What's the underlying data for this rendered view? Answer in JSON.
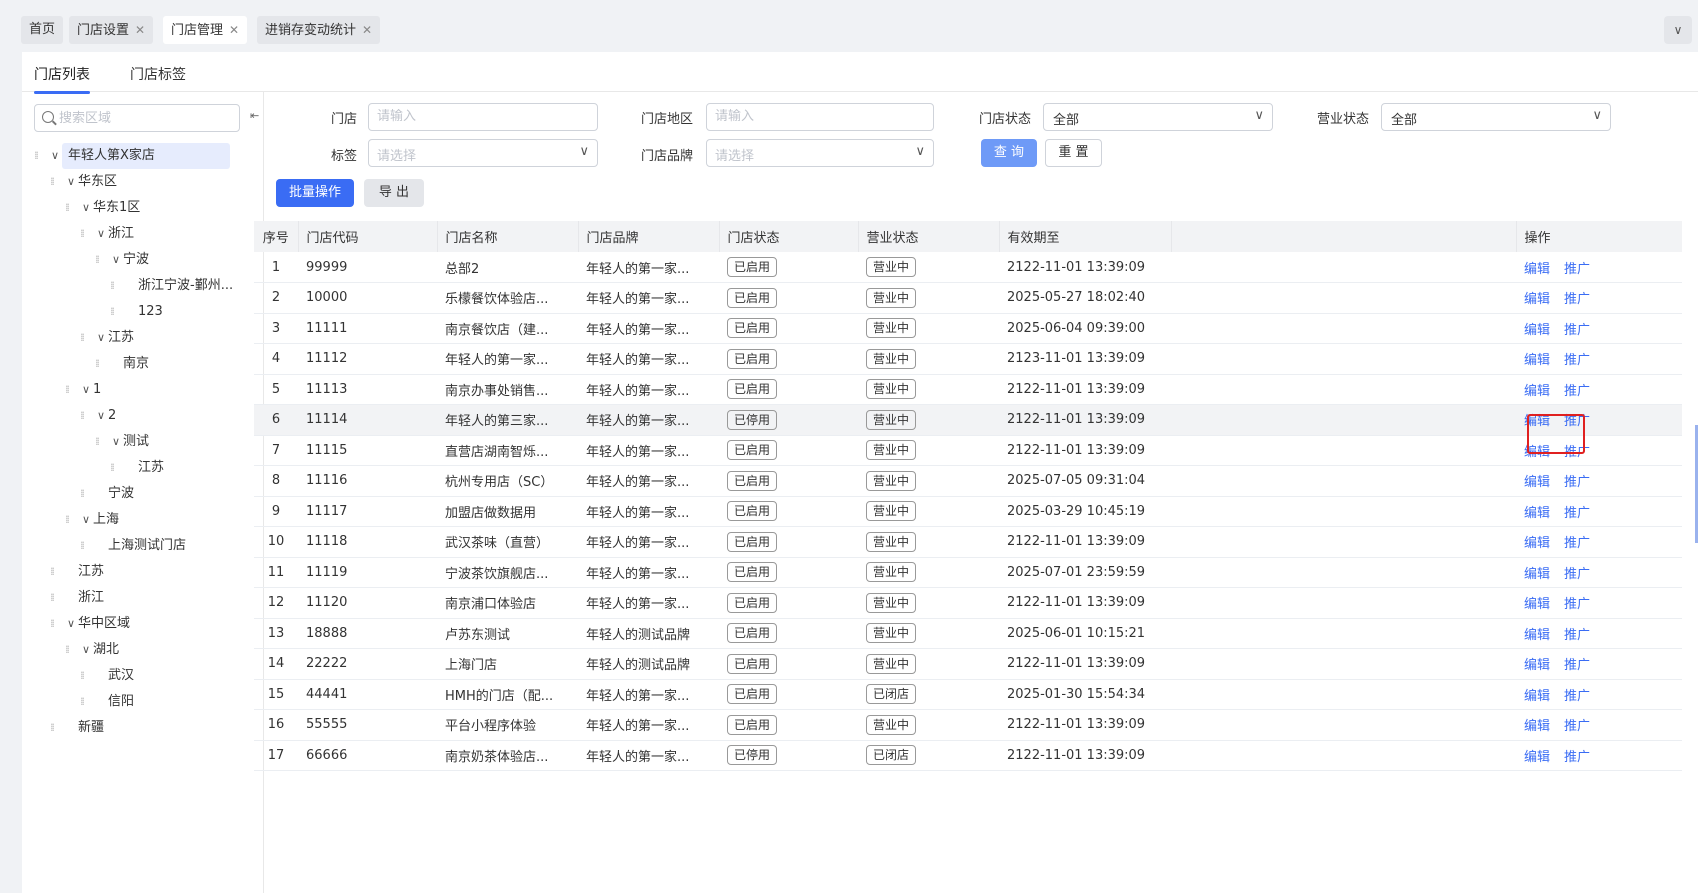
{
  "top_tabs": [
    {
      "label": "首页",
      "closable": false
    },
    {
      "label": "门店设置",
      "closable": true
    },
    {
      "label": "门店管理",
      "closable": true,
      "active": true
    },
    {
      "label": "进销存变动统计",
      "closable": true
    }
  ],
  "sub_tabs": [
    "门店列表",
    "门店标签"
  ],
  "tree": {
    "search_placeholder": "搜索区域",
    "nodes": [
      {
        "label": "年轻人第X家店",
        "level": 0,
        "expanded": true,
        "selected": true
      },
      {
        "label": "华东区",
        "level": 1,
        "expanded": true
      },
      {
        "label": "华东1区",
        "level": 2,
        "expanded": true
      },
      {
        "label": "浙江",
        "level": 3,
        "expanded": true
      },
      {
        "label": "宁波",
        "level": 4,
        "expanded": true
      },
      {
        "label": "浙江宁波-鄞州...",
        "level": 5,
        "leaf": true
      },
      {
        "label": "123",
        "level": 5,
        "leaf": true
      },
      {
        "label": "江苏",
        "level": 3,
        "expanded": true
      },
      {
        "label": "南京",
        "level": 4,
        "leaf": true
      },
      {
        "label": "1",
        "level": 2,
        "expanded": true
      },
      {
        "label": "2",
        "level": 3,
        "expanded": true
      },
      {
        "label": "测试",
        "level": 4,
        "expanded": true
      },
      {
        "label": "江苏",
        "level": 5,
        "leaf": true
      },
      {
        "label": "宁波",
        "level": 3,
        "leaf": true
      },
      {
        "label": "上海",
        "level": 2,
        "expanded": true
      },
      {
        "label": "上海测试门店",
        "level": 3,
        "leaf": true
      },
      {
        "label": "江苏",
        "level": 1,
        "leaf": true
      },
      {
        "label": "浙江",
        "level": 1,
        "leaf": true
      },
      {
        "label": "华中区域",
        "level": 1,
        "expanded": true
      },
      {
        "label": "湖北",
        "level": 2,
        "expanded": true
      },
      {
        "label": "武汉",
        "level": 3,
        "leaf": true
      },
      {
        "label": "信阳",
        "level": 3,
        "leaf": true
      },
      {
        "label": "新疆",
        "level": 1,
        "leaf": true
      }
    ]
  },
  "filters": {
    "store_label": "门店",
    "store_placeholder": "请输入",
    "region_label": "门店地区",
    "region_placeholder": "请输入",
    "status_label": "门店状态",
    "status_value": "全部",
    "biz_label": "营业状态",
    "biz_value": "全部",
    "tag_label": "标签",
    "tag_placeholder": "请选择",
    "brand_label": "门店品牌",
    "brand_placeholder": "请选择",
    "query_btn": "查 询",
    "reset_btn": "重 置"
  },
  "actions": {
    "batch": "批量操作",
    "export": "导 出"
  },
  "table": {
    "headers": [
      "序号",
      "门店代码",
      "门店名称",
      "门店品牌",
      "门店状态",
      "营业状态",
      "有效期至",
      "操作"
    ],
    "edit_label": "编辑",
    "promote_label": "推广",
    "rows": [
      {
        "idx": "1",
        "code": "99999",
        "name": "总部2",
        "brand": "年轻人的第一家...",
        "status": "已启用",
        "biz": "营业中",
        "expire": "2122-11-01 13:39:09"
      },
      {
        "idx": "2",
        "code": "10000",
        "name": "乐檬餐饮体验店...",
        "brand": "年轻人的第一家...",
        "status": "已启用",
        "biz": "营业中",
        "expire": "2025-05-27 18:02:40"
      },
      {
        "idx": "3",
        "code": "11111",
        "name": "南京餐饮店（建...",
        "brand": "年轻人的第一家...",
        "status": "已启用",
        "biz": "营业中",
        "expire": "2025-06-04 09:39:00"
      },
      {
        "idx": "4",
        "code": "11112",
        "name": "年轻人的第一家...",
        "brand": "年轻人的第一家...",
        "status": "已启用",
        "biz": "营业中",
        "expire": "2123-11-01 13:39:09"
      },
      {
        "idx": "5",
        "code": "11113",
        "name": "南京办事处销售...",
        "brand": "年轻人的第一家...",
        "status": "已启用",
        "biz": "营业中",
        "expire": "2122-11-01 13:39:09"
      },
      {
        "idx": "6",
        "code": "11114",
        "name": "年轻人的第三家...",
        "brand": "年轻人的第一家...",
        "status": "已停用",
        "biz": "营业中",
        "expire": "2122-11-01 13:39:09"
      },
      {
        "idx": "7",
        "code": "11115",
        "name": "直营店湖南智烁...",
        "brand": "年轻人的第一家...",
        "status": "已启用",
        "biz": "营业中",
        "expire": "2122-11-01 13:39:09"
      },
      {
        "idx": "8",
        "code": "11116",
        "name": "杭州专用店（SC）",
        "brand": "年轻人的第一家...",
        "status": "已启用",
        "biz": "营业中",
        "expire": "2025-07-05 09:31:04"
      },
      {
        "idx": "9",
        "code": "11117",
        "name": "加盟店做数据用",
        "brand": "年轻人的第一家...",
        "status": "已启用",
        "biz": "营业中",
        "expire": "2025-03-29 10:45:19"
      },
      {
        "idx": "10",
        "code": "11118",
        "name": "武汉茶味（直营）",
        "brand": "年轻人的第一家...",
        "status": "已启用",
        "biz": "营业中",
        "expire": "2122-11-01 13:39:09"
      },
      {
        "idx": "11",
        "code": "11119",
        "name": "宁波茶饮旗舰店...",
        "brand": "年轻人的第一家...",
        "status": "已启用",
        "biz": "营业中",
        "expire": "2025-07-01 23:59:59"
      },
      {
        "idx": "12",
        "code": "11120",
        "name": "南京浦口体验店",
        "brand": "年轻人的第一家...",
        "status": "已启用",
        "biz": "营业中",
        "expire": "2122-11-01 13:39:09"
      },
      {
        "idx": "13",
        "code": "18888",
        "name": "卢苏东测试",
        "brand": "年轻人的测试品牌",
        "status": "已启用",
        "biz": "营业中",
        "expire": "2025-06-01 10:15:21"
      },
      {
        "idx": "14",
        "code": "22222",
        "name": "上海门店",
        "brand": "年轻人的测试品牌",
        "status": "已启用",
        "biz": "营业中",
        "expire": "2122-11-01 13:39:09"
      },
      {
        "idx": "15",
        "code": "44441",
        "name": "HMH的门店（配...",
        "brand": "年轻人的第一家...",
        "status": "已启用",
        "biz": "已闭店",
        "expire": "2025-01-30 15:54:34"
      },
      {
        "idx": "16",
        "code": "55555",
        "name": "平台小程序体验",
        "brand": "年轻人的第一家...",
        "status": "已启用",
        "biz": "营业中",
        "expire": "2122-11-01 13:39:09"
      },
      {
        "idx": "17",
        "code": "66666",
        "name": "南京奶茶体验店...",
        "brand": "年轻人的第一家...",
        "status": "已停用",
        "biz": "已闭店",
        "expire": "2122-11-01 13:39:09"
      }
    ]
  }
}
